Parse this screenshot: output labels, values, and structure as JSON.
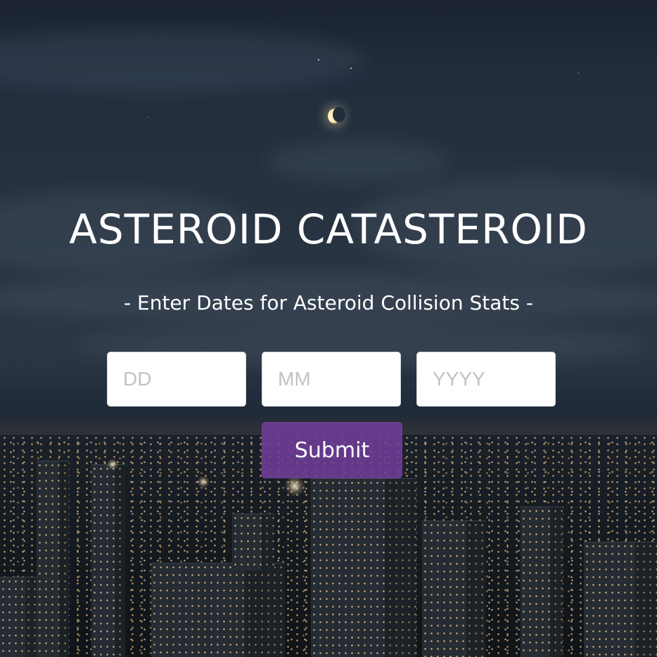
{
  "hero": {
    "title": "ASTEROID CATASTEROID",
    "subtitle": "- Enter Dates for Asteroid Collision Stats -"
  },
  "form": {
    "day": {
      "placeholder": "DD",
      "value": ""
    },
    "month": {
      "placeholder": "MM",
      "value": ""
    },
    "year": {
      "placeholder": "YYYY",
      "value": ""
    },
    "submit_label": "Submit"
  },
  "colors": {
    "submit_button": "#6e3c96",
    "text": "#ffffff"
  }
}
